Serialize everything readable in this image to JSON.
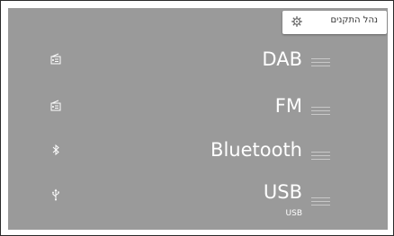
{
  "header": {
    "manage_button_label": "נהל התקנים",
    "manage_button_icon": "gear-icon"
  },
  "sources": [
    {
      "label": "DAB",
      "sublabel": "",
      "icon": "radio-icon"
    },
    {
      "label": "FM",
      "sublabel": "",
      "icon": "radio-icon"
    },
    {
      "label": "Bluetooth",
      "sublabel": "",
      "icon": "bluetooth-icon"
    },
    {
      "label": "USB",
      "sublabel": "USB",
      "icon": "usb-icon"
    }
  ],
  "colors": {
    "screen_background": "#9a9a9a",
    "text": "#ffffff",
    "handle": "#c8c8c8"
  }
}
